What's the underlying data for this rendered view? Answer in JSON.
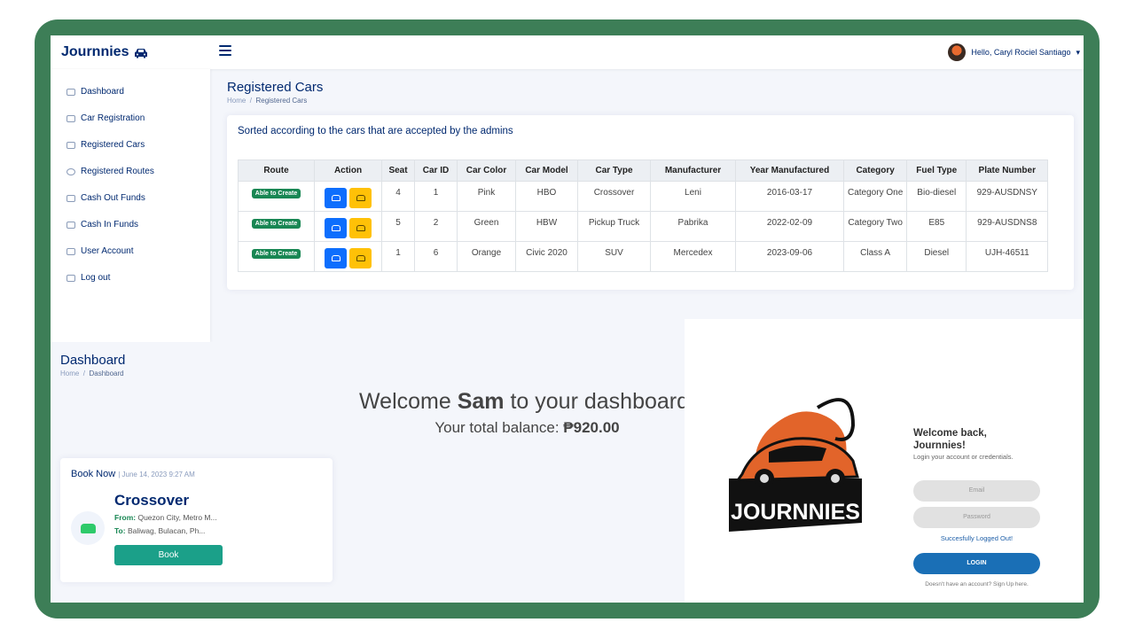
{
  "header": {
    "brand": "Journnies",
    "greeting": "Hello, Caryl Rociel Santiago"
  },
  "sidebar": {
    "items": [
      {
        "label": "Dashboard",
        "icon": "dashboard-icon"
      },
      {
        "label": "Car Registration",
        "icon": "people-icon"
      },
      {
        "label": "Registered Cars",
        "icon": "car-icon"
      },
      {
        "label": "Registered Routes",
        "icon": "route-icon"
      },
      {
        "label": "Cash Out Funds",
        "icon": "cashout-icon"
      },
      {
        "label": "Cash In Funds",
        "icon": "cashin-icon"
      },
      {
        "label": "User Account",
        "icon": "user-icon"
      },
      {
        "label": "Log out",
        "icon": "logout-icon"
      }
    ]
  },
  "cars_page": {
    "title": "Registered Cars",
    "breadcrumb": [
      "Home",
      "Registered Cars"
    ],
    "card_title": "Sorted according to the cars that are accepted by the admins",
    "columns": [
      "Route",
      "Action",
      "Seat",
      "Car ID",
      "Car Color",
      "Car Model",
      "Car Type",
      "Manufacturer",
      "Year Manufactured",
      "Category",
      "Fuel Type",
      "Plate Number"
    ],
    "rows": [
      {
        "route": "Able to Create",
        "seat": "4",
        "car_id": "1",
        "color": "Pink",
        "model": "HBO",
        "type": "Crossover",
        "manufacturer": "Leni",
        "year": "2016-03-17",
        "category": "Category One",
        "fuel": "Bio-diesel",
        "plate": "929-AUSDNSY"
      },
      {
        "route": "Able to Create",
        "seat": "5",
        "car_id": "2",
        "color": "Green",
        "model": "HBW",
        "type": "Pickup Truck",
        "manufacturer": "Pabrika",
        "year": "2022-02-09",
        "category": "Category Two",
        "fuel": "E85",
        "plate": "929-AUSDNS8"
      },
      {
        "route": "Able to Create",
        "seat": "1",
        "car_id": "6",
        "color": "Orange",
        "model": "Civic 2020",
        "type": "SUV",
        "manufacturer": "Mercedex",
        "year": "2023-09-06",
        "category": "Class A",
        "fuel": "Diesel",
        "plate": "UJH-46511"
      }
    ]
  },
  "dashboard": {
    "title": "Dashboard",
    "breadcrumb": [
      "Home",
      "Dashboard"
    ],
    "welcome_pre": "Welcome ",
    "welcome_name": "Sam",
    "welcome_post": " to your dashboard!",
    "balance_label": "Your total balance: ",
    "balance_value": "₱920.00",
    "book": {
      "title": "Book Now",
      "date": "| June 14, 2023 9:27 AM",
      "car_type": "Crossover",
      "from_label": "From:",
      "from": "Quezon City, Metro M...",
      "to_label": "To:",
      "to": "Baliwag, Bulacan, Ph...",
      "button": "Book"
    }
  },
  "login": {
    "logo_text": "JOURNNIES",
    "heading_1": "Welcome back,",
    "heading_2": "Journnies!",
    "subtitle": "Login your account or credentials.",
    "email_placeholder": "Email",
    "password_placeholder": "Password",
    "status": "Succesfully Logged Out!",
    "button": "LOGIN",
    "signup": "Doesn't have an account? Sign Up here."
  },
  "colors": {
    "frame": "#3d7e57",
    "navy": "#012970",
    "badge": "#198754",
    "action_blue": "#0d6efd",
    "action_yellow": "#ffc107",
    "book_button": "#1ba089",
    "login_button": "#1a6fb6"
  }
}
